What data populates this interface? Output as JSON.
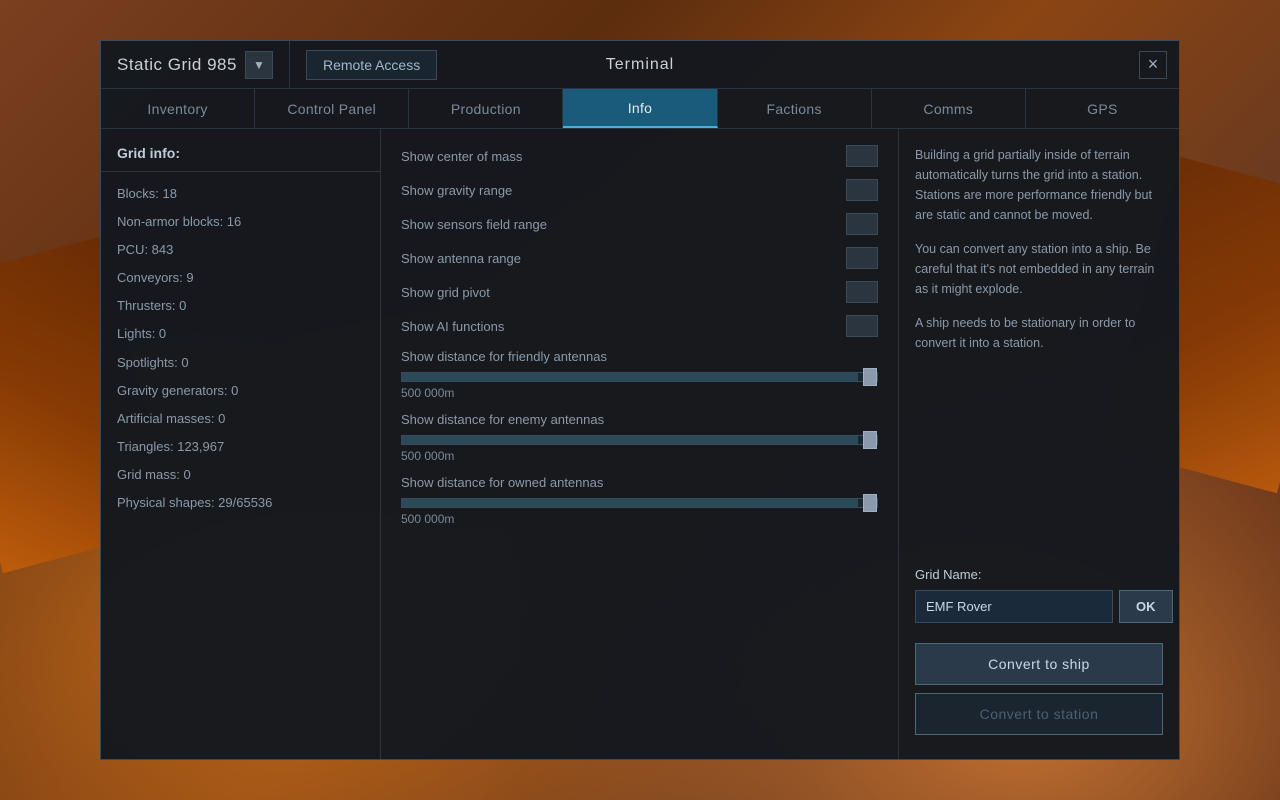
{
  "background": {
    "color": "#6b3a1f"
  },
  "modal": {
    "title": "Terminal",
    "close_label": "×"
  },
  "title_bar": {
    "grid_name": "Static Grid 985",
    "dropdown_icon": "▼",
    "remote_access_label": "Remote Access"
  },
  "tabs": [
    {
      "id": "inventory",
      "label": "Inventory",
      "active": false
    },
    {
      "id": "control-panel",
      "label": "Control Panel",
      "active": false
    },
    {
      "id": "production",
      "label": "Production",
      "active": false
    },
    {
      "id": "info",
      "label": "Info",
      "active": true
    },
    {
      "id": "factions",
      "label": "Factions",
      "active": false
    },
    {
      "id": "comms",
      "label": "Comms",
      "active": false
    },
    {
      "id": "gps",
      "label": "GPS",
      "active": false
    }
  ],
  "grid_info": {
    "title": "Grid info:",
    "stats": [
      {
        "label": "Blocks: 18"
      },
      {
        "label": "Non-armor blocks: 16"
      },
      {
        "label": "PCU: 843"
      },
      {
        "label": "Conveyors: 9"
      },
      {
        "label": "Thrusters: 0"
      },
      {
        "label": "Lights: 0"
      },
      {
        "label": "Spotlights: 0"
      },
      {
        "label": "Gravity generators: 0"
      },
      {
        "label": "Artificial masses: 0"
      },
      {
        "label": "Triangles: 123,967"
      },
      {
        "label": "Grid mass: 0"
      },
      {
        "label": "Physical shapes: 29/65536"
      }
    ]
  },
  "toggles": [
    {
      "id": "center-of-mass",
      "label": "Show center of mass",
      "checked": false
    },
    {
      "id": "gravity-range",
      "label": "Show gravity range",
      "checked": false
    },
    {
      "id": "sensors-field-range",
      "label": "Show sensors field range",
      "checked": false
    },
    {
      "id": "antenna-range",
      "label": "Show antenna range",
      "checked": false
    },
    {
      "id": "grid-pivot",
      "label": "Show grid pivot",
      "checked": false
    },
    {
      "id": "ai-functions",
      "label": "Show AI functions",
      "checked": false
    }
  ],
  "sliders": [
    {
      "id": "friendly-antennas",
      "label": "Show distance for friendly antennas",
      "value": "500 000m",
      "fill_pct": 98
    },
    {
      "id": "enemy-antennas",
      "label": "Show distance for enemy antennas",
      "value": "500 000m",
      "fill_pct": 98
    },
    {
      "id": "owned-antennas",
      "label": "Show distance for owned antennas",
      "value": "500 000m",
      "fill_pct": 98
    }
  ],
  "right_panel": {
    "info_paragraphs": [
      "Building a grid partially inside of terrain automatically turns the grid into a station. Stations are more performance friendly but are static and cannot be moved.",
      "You can convert any station into a ship. Be careful that it's not embedded in any terrain as it might explode.",
      "A ship needs to be stationary in order to convert it into a station."
    ],
    "grid_name_label": "Grid Name:",
    "grid_name_value": "EMF Rover",
    "grid_name_placeholder": "EMF Rover",
    "ok_label": "OK",
    "convert_ship_label": "Convert to ship",
    "convert_station_label": "Convert to station"
  }
}
